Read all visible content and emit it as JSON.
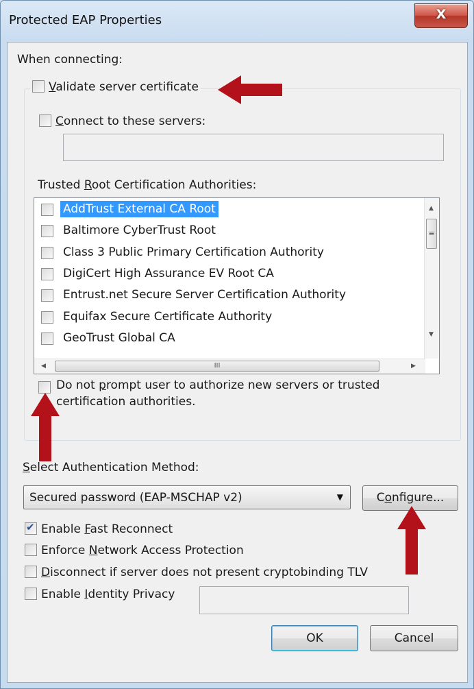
{
  "window": {
    "title": "Protected EAP Properties",
    "close_glyph": "X"
  },
  "connecting": {
    "heading": "When connecting:",
    "validate_cert": {
      "key": "V",
      "rest": "alidate server certificate",
      "checked": false
    },
    "connect_servers": {
      "key": "C",
      "rest": "onnect to these servers:",
      "checked": false,
      "value": ""
    },
    "trusted_root": {
      "before": "Trusted ",
      "key": "R",
      "rest": "oot Certification Authorities:"
    },
    "authorities": [
      {
        "label": "AddTrust External CA Root",
        "checked": false,
        "selected": true
      },
      {
        "label": "Baltimore CyberTrust Root",
        "checked": false,
        "selected": false
      },
      {
        "label": "Class 3 Public Primary Certification Authority",
        "checked": false,
        "selected": false
      },
      {
        "label": "DigiCert High Assurance EV Root CA",
        "checked": false,
        "selected": false
      },
      {
        "label": "Entrust.net Secure Server Certification Authority",
        "checked": false,
        "selected": false
      },
      {
        "label": "Equifax Secure Certificate Authority",
        "checked": false,
        "selected": false
      },
      {
        "label": "GeoTrust Global CA",
        "checked": false,
        "selected": false
      }
    ],
    "no_prompt": {
      "before": "Do not ",
      "key": "p",
      "rest": "rompt user to authorize new servers or trusted",
      "line2": "certification authorities.",
      "checked": false
    }
  },
  "auth": {
    "label_key": "S",
    "label_rest": "elect Authentication Method:",
    "method": "Secured password (EAP-MSCHAP v2)",
    "configure": {
      "before": "C",
      "key": "o",
      "rest": "nfigure..."
    }
  },
  "options": {
    "fast_reconnect": {
      "before": "Enable ",
      "key": "F",
      "rest": "ast Reconnect",
      "checked": true
    },
    "nap": {
      "before": "Enforce ",
      "key": "N",
      "rest": "etwork Access Protection",
      "checked": false
    },
    "cryptobinding": {
      "key": "D",
      "rest": "isconnect if server does not present cryptobinding TLV",
      "checked": false
    },
    "identity_privacy": {
      "before": "Enable ",
      "key": "I",
      "rest": "dentity Privacy",
      "checked": false,
      "value": ""
    }
  },
  "buttons": {
    "ok": "OK",
    "cancel": "Cancel"
  },
  "scrollbar_glyphs": {
    "grip": "≡",
    "hgrip": "III",
    "up": "▲",
    "down": "▼",
    "left": "◀",
    "right": "▶",
    "drop": "▼"
  },
  "annotation_color": "#b3121b"
}
